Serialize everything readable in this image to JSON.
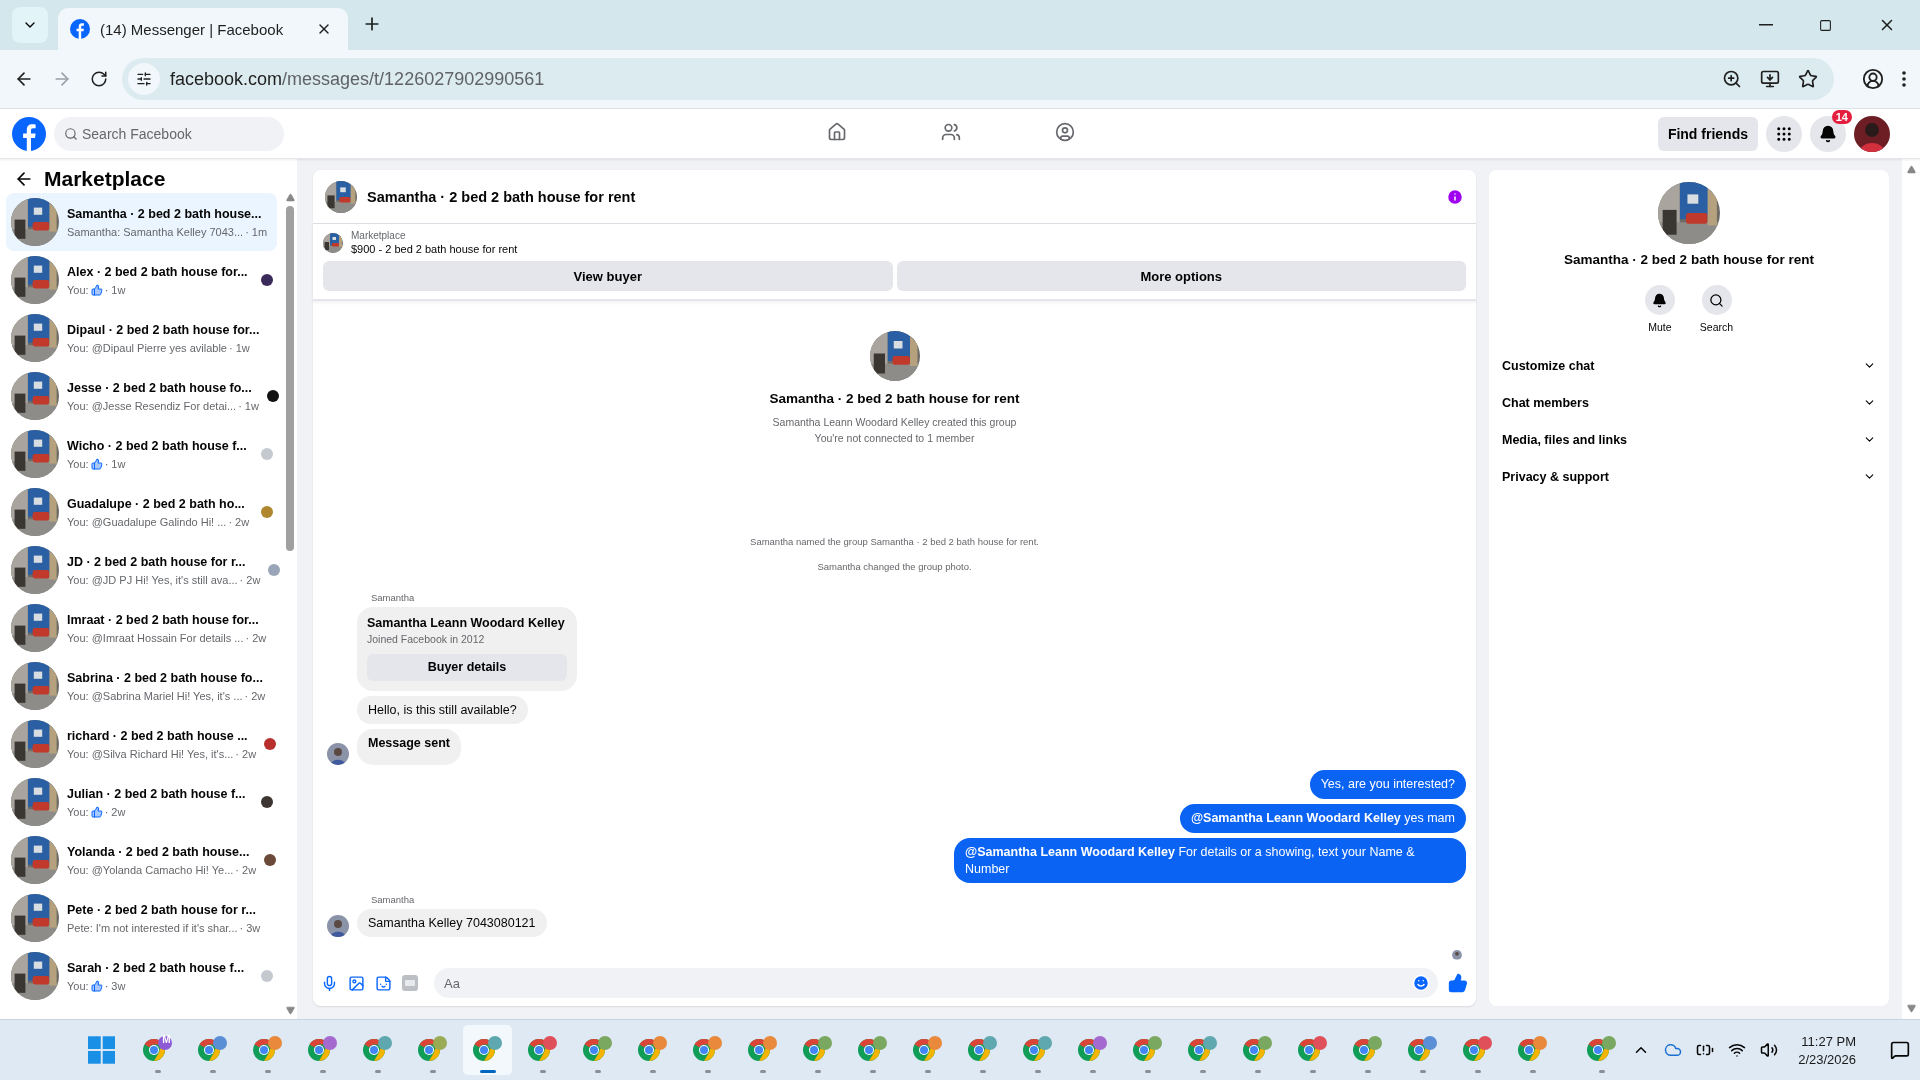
{
  "browser": {
    "tab_title": "(14) Messenger | Facebook",
    "url_domain": "facebook.com",
    "url_path": "/messages/t/1226027902990561"
  },
  "header": {
    "search_placeholder": "Search Facebook",
    "nav": [
      {
        "kind": "home",
        "selected": false
      },
      {
        "kind": "friends",
        "selected": false
      },
      {
        "kind": "profile",
        "selected": false
      }
    ],
    "find_friends": "Find friends",
    "notifications": "14"
  },
  "sidebar": {
    "title": "Marketplace",
    "conversations": [
      {
        "title": "Samantha · 2 bed 2 bath house...",
        "preview": "Samantha: Samantha Kelley 7043...",
        "time": "· 1m",
        "like": false,
        "selected": true
      },
      {
        "title": "Alex · 2 bed 2 bath house for...",
        "preview": "You:",
        "time": "· 1w",
        "like": true,
        "selected": false,
        "color": "#3a2a5a"
      },
      {
        "title": "Dipaul · 2 bed 2 bath house for...",
        "preview": "You: @Dipaul Pierre yes avilable",
        "time": "· 1w",
        "like": false,
        "selected": false
      },
      {
        "title": "Jesse · 2 bed 2 bath house fo...",
        "preview": "You: @Jesse Resendiz For detai...",
        "time": "· 1w",
        "like": false,
        "selected": false,
        "color": "#111111"
      },
      {
        "title": "Wicho · 2 bed 2 bath house f...",
        "preview": "You:",
        "time": "· 1w",
        "like": true,
        "selected": false,
        "color": "#c4c8cf"
      },
      {
        "title": "Guadalupe · 2 bed 2 bath ho...",
        "preview": "You: @Guadalupe Galindo Hi! ...",
        "time": "· 2w",
        "like": false,
        "selected": false,
        "color": "#b0862e"
      },
      {
        "title": "JD · 2 bed 2 bath house for r...",
        "preview": "You: @JD PJ Hi! Yes, it's still ava...",
        "time": "· 2w",
        "like": false,
        "selected": false,
        "color": "#9aa6b8"
      },
      {
        "title": "Imraat · 2 bed 2 bath house for...",
        "preview": "You: @Imraat Hossain For details ...",
        "time": "· 2w",
        "like": false,
        "selected": false
      },
      {
        "title": "Sabrina · 2 bed 2 bath house fo...",
        "preview": "You: @Sabrina Mariel Hi! Yes, it's ...",
        "time": "· 2w",
        "like": false,
        "selected": false
      },
      {
        "title": "richard · 2 bed 2 bath house ...",
        "preview": "You: @Silva Richard Hi! Yes, it's...",
        "time": "· 2w",
        "like": false,
        "selected": false,
        "color": "#b8302e"
      },
      {
        "title": "Julian · 2 bed 2 bath house f...",
        "preview": "You:",
        "time": "· 2w",
        "like": true,
        "selected": false,
        "color": "#3d3530"
      },
      {
        "title": "Yolanda · 2 bed 2 bath house...",
        "preview": "You: @Yolanda Camacho Hi! Ye...",
        "time": "· 2w",
        "like": false,
        "selected": false,
        "color": "#6b4a3a"
      },
      {
        "title": "Pete · 2 bed 2 bath house for r...",
        "preview": "Pete: I'm not interested if it's shar...",
        "time": "· 3w",
        "like": false,
        "selected": false
      },
      {
        "title": "Sarah · 2 bed 2 bath house f...",
        "preview": "You:",
        "time": "· 3w",
        "like": true,
        "selected": false,
        "color": "#c4c8cf"
      }
    ]
  },
  "chat": {
    "title": "Samantha · 2 bed 2 bath house for rent",
    "listing_label": "Marketplace",
    "listing": "$900 - 2 bed 2 bath house for rent",
    "actions": [
      "View buyer",
      "More options"
    ],
    "intro": {
      "title": "Samantha · 2 bed 2 bath house for rent",
      "lines": [
        "Samantha Leann Woodard Kelley created this group",
        "You're not connected to 1 member"
      ]
    },
    "thread": [
      {
        "kind": "system",
        "text": "Samantha named the group Samantha · 2 bed 2 bath house for rent."
      },
      {
        "kind": "system",
        "text": "Samantha changed the group photo."
      },
      {
        "kind": "sender",
        "text": "Samantha"
      },
      {
        "kind": "card",
        "name": "Samantha Leann Woodard Kelley",
        "meta": "Joined Facebook in 2012",
        "button": "Buyer details"
      },
      {
        "kind": "in",
        "text": "Hello, is this still available?",
        "avatar": false,
        "bold": false
      },
      {
        "kind": "in",
        "text": "Message sent",
        "avatar": true,
        "bold": true
      },
      {
        "kind": "out",
        "text": "Yes, are you interested?"
      },
      {
        "kind": "out",
        "text": "**@Samantha Leann Woodard Kelley** yes mam"
      },
      {
        "kind": "out",
        "text": "**@Samantha Leann Woodard Kelley** For details or a showing, text your Name & Number"
      },
      {
        "kind": "sender",
        "text": "Samantha"
      },
      {
        "kind": "in",
        "text": "Samantha Kelley 7043080121",
        "avatar": true,
        "bold": false
      },
      {
        "kind": "seen"
      }
    ],
    "composer_placeholder": "Aa"
  },
  "details": {
    "title": "Samantha · 2 bed 2 bath house for rent",
    "buttons": [
      {
        "kind": "mute",
        "label": "Mute"
      },
      {
        "kind": "search",
        "label": "Search"
      }
    ],
    "sections": [
      {
        "label": "Customize chat",
        "expanded": false
      },
      {
        "label": "Chat members",
        "expanded": false
      },
      {
        "label": "Media, files and links",
        "expanded": false
      },
      {
        "label": "Privacy & support",
        "expanded": false
      }
    ]
  },
  "taskbar": {
    "apps": [
      {
        "color": "#8e5bd6",
        "letter": "M",
        "selected": false
      },
      {
        "color": "#5a8fd6",
        "selected": false
      },
      {
        "color": "#e8893c",
        "selected": false
      },
      {
        "color": "#a46ad0",
        "selected": false
      },
      {
        "color": "#5fa8b0",
        "selected": false
      },
      {
        "color": "#9aab55",
        "selected": false
      },
      {
        "color": "#5fa8b0",
        "selected": true
      },
      {
        "color": "#e0505a",
        "selected": false
      },
      {
        "color": "#7aa860",
        "selected": false
      },
      {
        "color": "#e8893c",
        "selected": false
      },
      {
        "color": "#e8893c",
        "selected": false
      },
      {
        "color": "#e8893c",
        "selected": false
      },
      {
        "color": "#7aa860",
        "selected": false
      },
      {
        "color": "#7aa860",
        "selected": false
      },
      {
        "color": "#e8893c",
        "selected": false
      },
      {
        "color": "#5fa8b0",
        "selected": false
      },
      {
        "color": "#5fa8b0",
        "selected": false
      },
      {
        "color": "#a46ad0",
        "selected": false
      },
      {
        "color": "#7aa860",
        "selected": false
      },
      {
        "color": "#5fa8b0",
        "selected": false
      },
      {
        "color": "#7aa860",
        "selected": false
      },
      {
        "color": "#e0505a",
        "selected": false
      },
      {
        "color": "#7aa860",
        "selected": false
      },
      {
        "color": "#5a8fd6",
        "selected": false
      },
      {
        "color": "#e0505a",
        "selected": false
      },
      {
        "color": "#e8893c",
        "selected": false
      },
      {
        "color": "#7aa860",
        "selected": false
      }
    ],
    "time": "11:27 PM",
    "date": "2/23/2026"
  }
}
